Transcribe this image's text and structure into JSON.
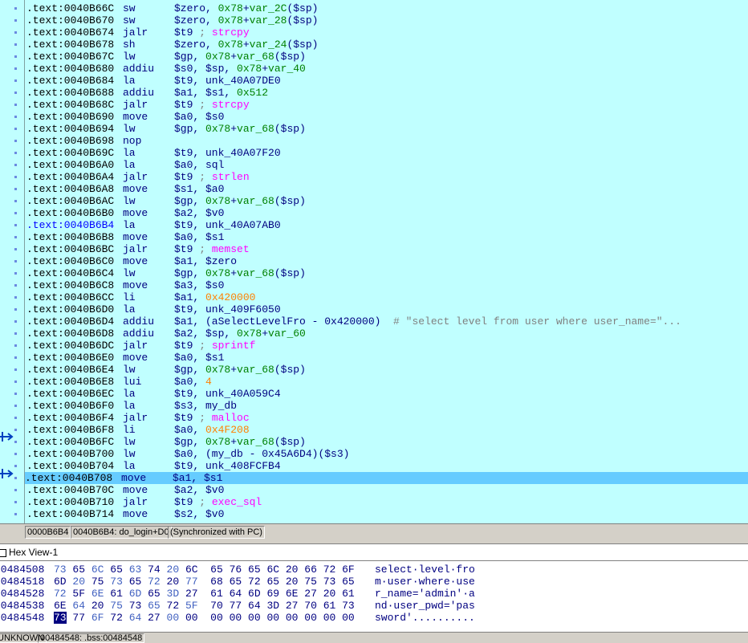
{
  "disasm": {
    "lines": [
      {
        "addr": ".text:0040B66C",
        "mn": "sw",
        "ops": [
          {
            "t": "$zero, ",
            "c": "op"
          },
          {
            "t": "0x78",
            "c": "num"
          },
          {
            "t": "+",
            "c": "op"
          },
          {
            "t": "var_2C",
            "c": "num"
          },
          {
            "t": "($sp)",
            "c": "op"
          }
        ]
      },
      {
        "addr": ".text:0040B670",
        "mn": "sw",
        "ops": [
          {
            "t": "$zero, ",
            "c": "op"
          },
          {
            "t": "0x78",
            "c": "num"
          },
          {
            "t": "+",
            "c": "op"
          },
          {
            "t": "var_28",
            "c": "num"
          },
          {
            "t": "($sp)",
            "c": "op"
          }
        ]
      },
      {
        "addr": ".text:0040B674",
        "mn": "jalr",
        "ops": [
          {
            "t": "$t9 ",
            "c": "op"
          },
          {
            "t": "; ",
            "c": "cm"
          },
          {
            "t": "strcpy",
            "c": "fn"
          }
        ]
      },
      {
        "addr": ".text:0040B678",
        "mn": "sh",
        "ops": [
          {
            "t": "$zero, ",
            "c": "op"
          },
          {
            "t": "0x78",
            "c": "num"
          },
          {
            "t": "+",
            "c": "op"
          },
          {
            "t": "var_24",
            "c": "num"
          },
          {
            "t": "($sp)",
            "c": "op"
          }
        ]
      },
      {
        "addr": ".text:0040B67C",
        "mn": "lw",
        "ops": [
          {
            "t": "$gp, ",
            "c": "op"
          },
          {
            "t": "0x78",
            "c": "num"
          },
          {
            "t": "+",
            "c": "op"
          },
          {
            "t": "var_68",
            "c": "num"
          },
          {
            "t": "($sp)",
            "c": "op"
          }
        ]
      },
      {
        "addr": ".text:0040B680",
        "mn": "addiu",
        "ops": [
          {
            "t": "$s0, $sp, ",
            "c": "op"
          },
          {
            "t": "0x78",
            "c": "num"
          },
          {
            "t": "+",
            "c": "op"
          },
          {
            "t": "var_40",
            "c": "num"
          }
        ]
      },
      {
        "addr": ".text:0040B684",
        "mn": "la",
        "ops": [
          {
            "t": "$t9, unk_40A07DE0",
            "c": "op"
          }
        ]
      },
      {
        "addr": ".text:0040B688",
        "mn": "addiu",
        "ops": [
          {
            "t": "$a1, $s1, ",
            "c": "op"
          },
          {
            "t": "0x512",
            "c": "num"
          }
        ]
      },
      {
        "addr": ".text:0040B68C",
        "mn": "jalr",
        "ops": [
          {
            "t": "$t9 ",
            "c": "op"
          },
          {
            "t": "; ",
            "c": "cm"
          },
          {
            "t": "strcpy",
            "c": "fn"
          }
        ]
      },
      {
        "addr": ".text:0040B690",
        "mn": "move",
        "ops": [
          {
            "t": "$a0, $s0",
            "c": "op"
          }
        ]
      },
      {
        "addr": ".text:0040B694",
        "mn": "lw",
        "ops": [
          {
            "t": "$gp, ",
            "c": "op"
          },
          {
            "t": "0x78",
            "c": "num"
          },
          {
            "t": "+",
            "c": "op"
          },
          {
            "t": "var_68",
            "c": "num"
          },
          {
            "t": "($sp)",
            "c": "op"
          }
        ]
      },
      {
        "addr": ".text:0040B698",
        "mn": "nop",
        "ops": []
      },
      {
        "addr": ".text:0040B69C",
        "mn": "la",
        "ops": [
          {
            "t": "$t9, unk_40A07F20",
            "c": "op"
          }
        ]
      },
      {
        "addr": ".text:0040B6A0",
        "mn": "la",
        "ops": [
          {
            "t": "$a0, sql",
            "c": "op"
          }
        ]
      },
      {
        "addr": ".text:0040B6A4",
        "mn": "jalr",
        "ops": [
          {
            "t": "$t9 ",
            "c": "op"
          },
          {
            "t": "; ",
            "c": "cm"
          },
          {
            "t": "strlen",
            "c": "fn"
          }
        ]
      },
      {
        "addr": ".text:0040B6A8",
        "mn": "move",
        "ops": [
          {
            "t": "$s1, $a0",
            "c": "op"
          }
        ]
      },
      {
        "addr": ".text:0040B6AC",
        "mn": "lw",
        "ops": [
          {
            "t": "$gp, ",
            "c": "op"
          },
          {
            "t": "0x78",
            "c": "num"
          },
          {
            "t": "+",
            "c": "op"
          },
          {
            "t": "var_68",
            "c": "num"
          },
          {
            "t": "($sp)",
            "c": "op"
          }
        ]
      },
      {
        "addr": ".text:0040B6B0",
        "mn": "move",
        "ops": [
          {
            "t": "$a2, $v0",
            "c": "op"
          }
        ]
      },
      {
        "addr": ".text:0040B6B4",
        "mn": "la",
        "cur": true,
        "ops": [
          {
            "t": "$t9, unk_40A07AB0",
            "c": "op"
          }
        ]
      },
      {
        "addr": ".text:0040B6B8",
        "mn": "move",
        "ops": [
          {
            "t": "$a0, $s1",
            "c": "op"
          }
        ]
      },
      {
        "addr": ".text:0040B6BC",
        "mn": "jalr",
        "ops": [
          {
            "t": "$t9 ",
            "c": "op"
          },
          {
            "t": "; ",
            "c": "cm"
          },
          {
            "t": "memset",
            "c": "fn"
          }
        ]
      },
      {
        "addr": ".text:0040B6C0",
        "mn": "move",
        "ops": [
          {
            "t": "$a1, $zero",
            "c": "op"
          }
        ]
      },
      {
        "addr": ".text:0040B6C4",
        "mn": "lw",
        "ops": [
          {
            "t": "$gp, ",
            "c": "op"
          },
          {
            "t": "0x78",
            "c": "num"
          },
          {
            "t": "+",
            "c": "op"
          },
          {
            "t": "var_68",
            "c": "num"
          },
          {
            "t": "($sp)",
            "c": "op"
          }
        ]
      },
      {
        "addr": ".text:0040B6C8",
        "mn": "move",
        "ops": [
          {
            "t": "$a3, $s0",
            "c": "op"
          }
        ]
      },
      {
        "addr": ".text:0040B6CC",
        "mn": "li",
        "ops": [
          {
            "t": "$a1, ",
            "c": "op"
          },
          {
            "t": "0x420000",
            "c": "orange"
          }
        ]
      },
      {
        "addr": ".text:0040B6D0",
        "mn": "la",
        "ops": [
          {
            "t": "$t9, unk_409F6050",
            "c": "op"
          }
        ]
      },
      {
        "addr": ".text:0040B6D4",
        "mn": "addiu",
        "ops": [
          {
            "t": "$a1, (aSelectLevelFro - 0x420000)  ",
            "c": "op"
          },
          {
            "t": "# \"select level from user where user_name=\"...",
            "c": "cm"
          }
        ]
      },
      {
        "addr": ".text:0040B6D8",
        "mn": "addiu",
        "ops": [
          {
            "t": "$a2, $sp, ",
            "c": "op"
          },
          {
            "t": "0x78",
            "c": "num"
          },
          {
            "t": "+",
            "c": "op"
          },
          {
            "t": "var_60",
            "c": "num"
          }
        ]
      },
      {
        "addr": ".text:0040B6DC",
        "mn": "jalr",
        "ops": [
          {
            "t": "$t9 ",
            "c": "op"
          },
          {
            "t": "; ",
            "c": "cm"
          },
          {
            "t": "sprintf",
            "c": "fn"
          }
        ]
      },
      {
        "addr": ".text:0040B6E0",
        "mn": "move",
        "ops": [
          {
            "t": "$a0, $s1",
            "c": "op"
          }
        ]
      },
      {
        "addr": ".text:0040B6E4",
        "mn": "lw",
        "ops": [
          {
            "t": "$gp, ",
            "c": "op"
          },
          {
            "t": "0x78",
            "c": "num"
          },
          {
            "t": "+",
            "c": "op"
          },
          {
            "t": "var_68",
            "c": "num"
          },
          {
            "t": "($sp)",
            "c": "op"
          }
        ]
      },
      {
        "addr": ".text:0040B6E8",
        "mn": "lui",
        "ops": [
          {
            "t": "$a0, ",
            "c": "op"
          },
          {
            "t": "4",
            "c": "orange"
          }
        ]
      },
      {
        "addr": ".text:0040B6EC",
        "mn": "la",
        "ops": [
          {
            "t": "$t9, unk_40A059C4",
            "c": "op"
          }
        ]
      },
      {
        "addr": ".text:0040B6F0",
        "mn": "la",
        "ops": [
          {
            "t": "$s3, my_db",
            "c": "op"
          }
        ]
      },
      {
        "addr": ".text:0040B6F4",
        "mn": "jalr",
        "ops": [
          {
            "t": "$t9 ",
            "c": "op"
          },
          {
            "t": "; ",
            "c": "cm"
          },
          {
            "t": "malloc",
            "c": "fn"
          }
        ]
      },
      {
        "addr": ".text:0040B6F8",
        "mn": "li",
        "ops": [
          {
            "t": "$a0, ",
            "c": "op"
          },
          {
            "t": "0x4F208",
            "c": "orange"
          }
        ]
      },
      {
        "addr": ".text:0040B6FC",
        "mn": "lw",
        "ops": [
          {
            "t": "$gp, ",
            "c": "op"
          },
          {
            "t": "0x78",
            "c": "num"
          },
          {
            "t": "+",
            "c": "op"
          },
          {
            "t": "var_68",
            "c": "num"
          },
          {
            "t": "($sp)",
            "c": "op"
          }
        ]
      },
      {
        "addr": ".text:0040B700",
        "mn": "lw",
        "ops": [
          {
            "t": "$a0, (my_db - ",
            "c": "op"
          },
          {
            "t": "0x45A6D4",
            "c": "op"
          },
          {
            "t": ")($s3)",
            "c": "op"
          }
        ]
      },
      {
        "addr": ".text:0040B704",
        "mn": "la",
        "ops": [
          {
            "t": "$t9, unk_408FCFB4",
            "c": "op"
          }
        ]
      },
      {
        "addr": ".text:0040B708",
        "mn": "move",
        "sel": true,
        "ops": [
          {
            "t": "$a1, $s1",
            "c": "op"
          }
        ]
      },
      {
        "addr": ".text:0040B70C",
        "mn": "move",
        "ops": [
          {
            "t": "$a2, $v0",
            "c": "op"
          }
        ]
      },
      {
        "addr": ".text:0040B710",
        "mn": "jalr",
        "ops": [
          {
            "t": "$t9 ",
            "c": "op"
          },
          {
            "t": "; ",
            "c": "cm"
          },
          {
            "t": "exec_sql",
            "c": "fn"
          }
        ]
      },
      {
        "addr": ".text:0040B714",
        "mn": "move",
        "ops": [
          {
            "t": "$s2, $v0",
            "c": "op"
          }
        ]
      }
    ]
  },
  "status_bar": {
    "offset": "0000B6B4",
    "location": "0040B6B4: do_login+D0",
    "sync": "(Synchronized with PC)"
  },
  "hex_view": {
    "title": "Hex View-1",
    "rows": [
      {
        "addr": "00484508",
        "bytes": [
          "73",
          "65",
          "6C",
          "65",
          "63",
          "74",
          "20",
          "6C",
          "65",
          "76",
          "65",
          "6C",
          "20",
          "66",
          "72",
          "6F"
        ],
        "ascii": "select·level·fro"
      },
      {
        "addr": "00484518",
        "bytes": [
          "6D",
          "20",
          "75",
          "73",
          "65",
          "72",
          "20",
          "77",
          "68",
          "65",
          "72",
          "65",
          "20",
          "75",
          "73",
          "65"
        ],
        "ascii": "m·user·where·use"
      },
      {
        "addr": "00484528",
        "bytes": [
          "72",
          "5F",
          "6E",
          "61",
          "6D",
          "65",
          "3D",
          "27",
          "61",
          "64",
          "6D",
          "69",
          "6E",
          "27",
          "20",
          "61"
        ],
        "ascii": "r_name='admin'·a"
      },
      {
        "addr": "00484538",
        "bytes": [
          "6E",
          "64",
          "20",
          "75",
          "73",
          "65",
          "72",
          "5F",
          "70",
          "77",
          "64",
          "3D",
          "27",
          "70",
          "61",
          "73"
        ],
        "ascii": "nd·user_pwd='pas"
      },
      {
        "addr": "00484548",
        "bytes": [
          "73",
          "77",
          "6F",
          "72",
          "64",
          "27",
          "00",
          "00",
          "00",
          "00",
          "00",
          "00",
          "00",
          "00",
          "00",
          "00"
        ],
        "ascii": "sword'.........."
      }
    ]
  },
  "hex_status": {
    "mode": "UNKNOWN",
    "location": "00484548: .bss:00484548"
  }
}
